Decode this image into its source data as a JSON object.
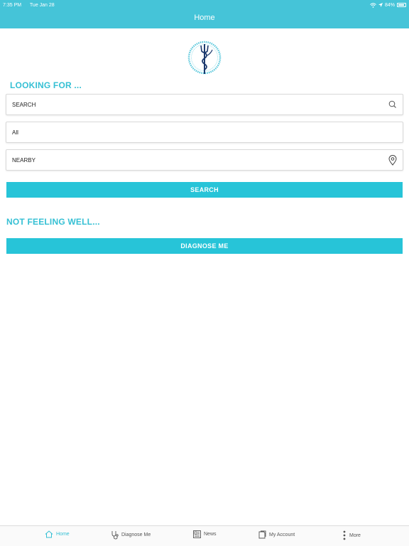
{
  "status_bar": {
    "time": "7:35 PM",
    "date": "Tue Jan 28",
    "battery": "84%"
  },
  "header": {
    "title": "Home"
  },
  "looking_for": {
    "title": "LOOKING FOR ...",
    "search_field": "SEARCH",
    "category_field": "All",
    "location_field": "NEARBY",
    "search_button": "SEARCH"
  },
  "not_feeling_well": {
    "title": "NOT FEELING WELL...",
    "diagnose_button": "DIAGNOSE ME"
  },
  "tabbar": {
    "items": [
      {
        "label": "Home",
        "icon": "home-icon",
        "active": true
      },
      {
        "label": "Diagnose Me",
        "icon": "stethoscope-icon",
        "active": false
      },
      {
        "label": "News",
        "icon": "news-icon",
        "active": false
      },
      {
        "label": "My Account",
        "icon": "account-icon",
        "active": false
      },
      {
        "label": "More",
        "icon": "more-vertical-icon",
        "active": false
      }
    ]
  },
  "colors": {
    "accent": "#36c0d4",
    "header": "#45c4d8",
    "button": "#27c4d8"
  }
}
